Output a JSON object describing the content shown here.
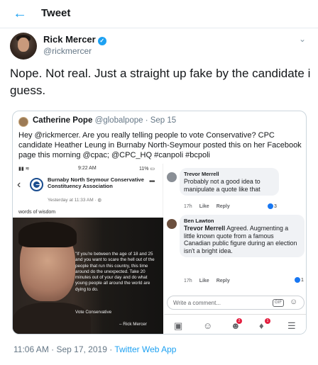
{
  "header": {
    "back_icon": "arrow-left-icon",
    "title": "Tweet",
    "accent": "#1da1f2"
  },
  "author": {
    "name": "Rick Mercer",
    "handle": "@rickmercer",
    "verified": true
  },
  "tweet": {
    "text": "Nope. Not real. Just a straight up fake by the candidate i guess."
  },
  "quoted": {
    "name": "Catherine Pope",
    "handle": "@globalpope",
    "date": "· Sep 15",
    "text": "Hey @rickmercer. Are you really telling people to vote Conservative? CPC candidate Heather Leung in Burnaby North-Seymour posted this on her Facebook page this morning @cpac; @CPC_HQ #canpoli #bcpoli"
  },
  "screenshot": {
    "status": {
      "signal": "▮▮ ≋",
      "time": "9:22 AM",
      "battery": "11% ▭"
    },
    "org_name": "Burnaby North Seymour Conservative Constituency Association",
    "org_time": "Yesterday at 11:33 AM · ◍",
    "caption": "words of wisdom",
    "image_quote": "\"If you're between the age of 18 and 25 and you want to scare the hell out of the people that run this country, this time around do the unexpected. Take 20 minutes out of your day and do what young people all around the world are dying to do.",
    "image_vote": "Vote Conservative",
    "image_sig": "– Rick Mercer",
    "comments": [
      {
        "author": "Trevor Merrell",
        "text": "Probably not a good idea to manipulate a quote like that",
        "time": "17h",
        "like": "Like",
        "reply": "Reply",
        "reactions": "3"
      },
      {
        "author": "Ben Lawton",
        "mention": "Trevor Merrell",
        "text": " Agreed. Augmenting a little known quote from a famous Canadian public figure during an election isn't a bright idea.",
        "time": "17h",
        "like": "Like",
        "reply": "Reply",
        "reactions": "1"
      }
    ],
    "compose_placeholder": "Write a comment...",
    "gif_label": "GIF",
    "nav_badges": {
      "groups": "2",
      "notifications": "1"
    }
  },
  "footer": {
    "timestamp": "11:06 AM · Sep 17, 2019 · ",
    "app": "Twitter Web App"
  }
}
